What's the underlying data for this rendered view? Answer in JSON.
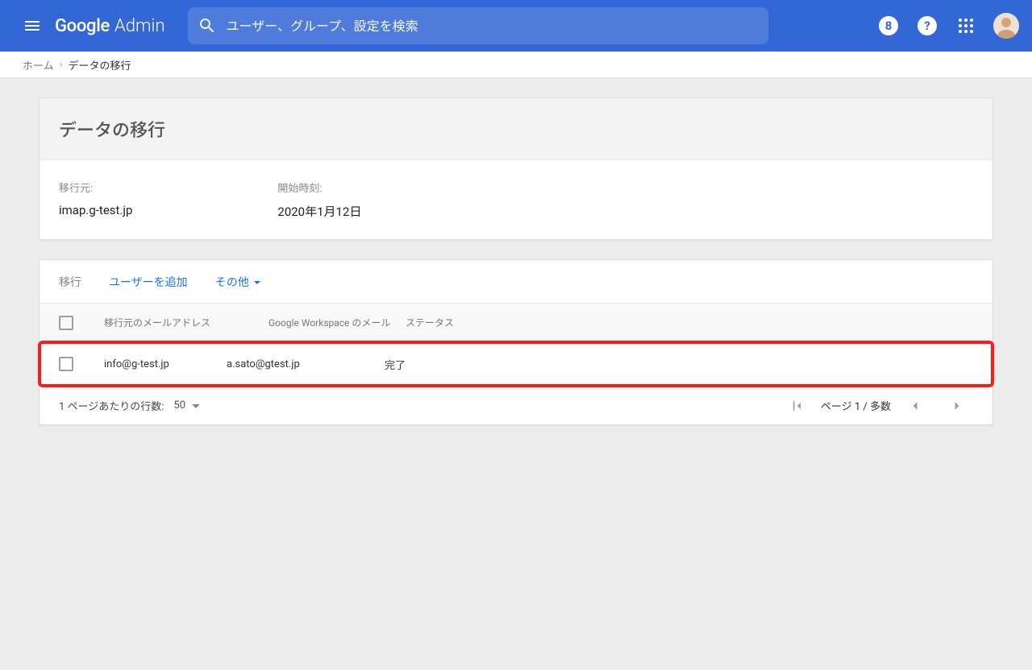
{
  "header": {
    "logo_google": "Google",
    "logo_admin": "Admin",
    "search": {
      "placeholder": "ユーザー、グループ、設定を検索"
    }
  },
  "breadcrumb": {
    "home": "ホーム",
    "current": "データの移行"
  },
  "summary": {
    "title": "データの移行",
    "source_label": "移行元:",
    "source_value": "imap.g-test.jp",
    "start_label": "開始時刻:",
    "start_value": "2020年1月12日"
  },
  "toolbar": {
    "label": "移行",
    "add_user": "ユーザーを追加",
    "more": "その他"
  },
  "columns": {
    "source": "移行元のメールアドレス",
    "gws": "Google Workspace のメール",
    "status": "ステータス"
  },
  "rows": [
    {
      "source": "info@g-test.jp",
      "gws": "a.sato@gtest.jp",
      "status": "完了"
    }
  ],
  "pager": {
    "rows_label": "1 ページあたりの行数:",
    "rows_value": "50",
    "page_text": "ページ 1 / 多数"
  }
}
